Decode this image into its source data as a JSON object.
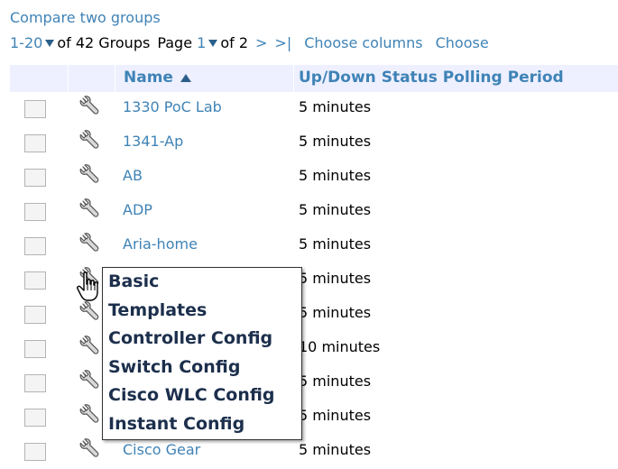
{
  "compare_link": "Compare two groups",
  "pager": {
    "range": "1-20",
    "of_groups": "of 42 Groups",
    "page_label": "Page",
    "page_current": "1",
    "page_total": "of 2",
    "next": ">",
    "last": ">|",
    "choose_columns": "Choose columns",
    "choose_more": "Choose"
  },
  "table": {
    "col_name": "Name",
    "col_polling": "Up/Down Status Polling Period",
    "rows": [
      {
        "name": "1330 PoC Lab",
        "polling": "5 minutes"
      },
      {
        "name": "1341-Ap",
        "polling": "5 minutes"
      },
      {
        "name": "AB",
        "polling": "5 minutes"
      },
      {
        "name": "ADP",
        "polling": "5 minutes"
      },
      {
        "name": "Aria-home",
        "polling": "5 minutes"
      },
      {
        "name": "",
        "polling": "5 minutes"
      },
      {
        "name": "",
        "polling": "5 minutes"
      },
      {
        "name": "",
        "polling": "10 minutes"
      },
      {
        "name": "",
        "polling": "5 minutes"
      },
      {
        "name": "",
        "polling": "5 minutes"
      },
      {
        "name": "Cisco Gear",
        "polling": "5 minutes"
      }
    ]
  },
  "menu": {
    "items": [
      "Basic",
      "Templates",
      "Controller Config",
      "Switch Config",
      "Cisco WLC Config",
      "Instant Config"
    ]
  },
  "icons": {
    "row_action": "wrench-icon",
    "cursor": "hand-pointer-icon"
  },
  "colors": {
    "link": "#3f83b6",
    "header_bg": "#eef0ff"
  }
}
